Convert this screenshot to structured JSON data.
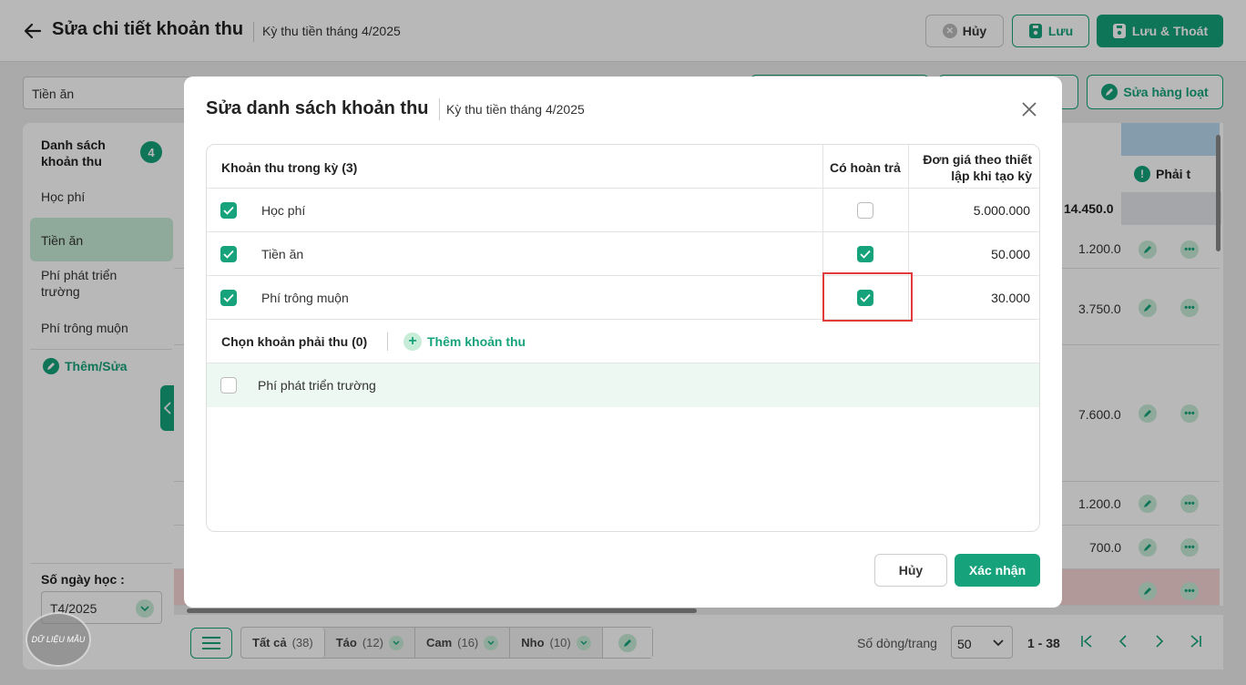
{
  "header": {
    "title": "Sửa chi tiết khoản thu",
    "subtitle": "Kỳ thu tiền tháng 4/2025",
    "cancel_label": "Hủy",
    "save_label": "Lưu",
    "save_exit_label": "Lưu & Thoát"
  },
  "toolbar": {
    "filter_value": "Tiền ăn",
    "bulk_edit_label": "Sửa hàng loạt"
  },
  "sidebar": {
    "heading": "Danh sách khoản thu",
    "count": "4",
    "items": [
      {
        "label": "Học phí"
      },
      {
        "label": "Tiền ăn"
      },
      {
        "label": "Phí phát triển trường"
      },
      {
        "label": "Phí trông muộn"
      }
    ],
    "add_edit_label": "Thêm/Sửa",
    "days_label": "Số ngày học :",
    "month_value": "T4/2025"
  },
  "grid": {
    "column_label": "Phải t",
    "total": "14.450.0",
    "rows": [
      {
        "value": "1.200.0"
      },
      {
        "value": "3.750.0"
      },
      {
        "value": "7.600.0"
      },
      {
        "value": "1.200.0"
      },
      {
        "value": "700.0"
      },
      {
        "value": ""
      }
    ]
  },
  "footer": {
    "chips": [
      {
        "label": "Tất cả",
        "count": "(38)"
      },
      {
        "label": "Táo",
        "count": "(12)"
      },
      {
        "label": "Cam",
        "count": "(16)"
      },
      {
        "label": "Nho",
        "count": "(10)"
      }
    ],
    "page_size_label": "Số dòng/trang",
    "page_size": "50",
    "range": "1 - 38"
  },
  "watermark": "DỮ LIỆU MẪU",
  "modal": {
    "title": "Sửa danh sách khoản thu",
    "subtitle": "Kỳ thu tiền tháng 4/2025",
    "col_name": "Khoản thu trong kỳ (3)",
    "col_refund": "Có hoàn trả",
    "col_price": "Đơn giá theo thiết lập khi tạo kỳ",
    "rows": [
      {
        "name": "Học phí",
        "refund": false,
        "price": "5.000.000"
      },
      {
        "name": "Tiền ăn",
        "refund": true,
        "price": "50.000"
      },
      {
        "name": "Phí trông muộn",
        "refund": true,
        "price": "30.000"
      }
    ],
    "section_title": "Chọn khoản phải thu (0)",
    "add_label": "Thêm khoản thu",
    "options": [
      {
        "name": "Phí phát triển trường"
      }
    ],
    "cancel_label": "Hủy",
    "confirm_label": "Xác nhận"
  },
  "colors": {
    "accent": "#16a37b",
    "accent_light": "#c7ecd7",
    "highlight": "#e23b3b"
  }
}
